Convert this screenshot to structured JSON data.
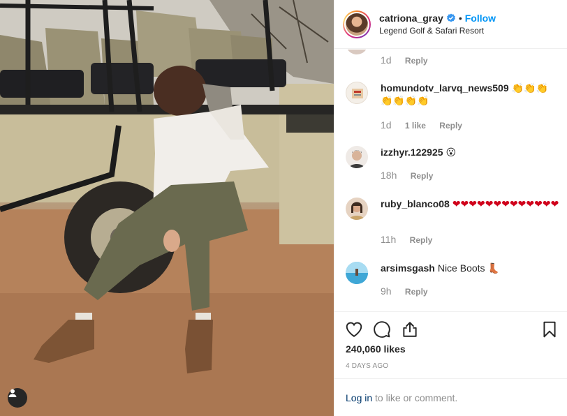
{
  "photo": {
    "description_icon": "user-tag-icon"
  },
  "header": {
    "username": "catriona_gray",
    "verified_icon": "verified-badge-icon",
    "separator": "•",
    "follow_label": "Follow",
    "location": "Legend Golf & Safari Resort"
  },
  "comments": [
    {
      "username": "",
      "text": "",
      "time": "1d",
      "likes": "",
      "reply": "Reply"
    },
    {
      "username": "homundotv_larvq_news509",
      "text": "👏👏👏👏👏👏👏",
      "time": "1d",
      "likes": "1 like",
      "reply": "Reply"
    },
    {
      "username": "izzhyr.122925",
      "text": "😮",
      "time": "18h",
      "likes": "",
      "reply": "Reply"
    },
    {
      "username": "ruby_blanco08",
      "text": "❤❤❤❤❤❤❤❤❤❤❤❤❤",
      "time": "11h",
      "likes": "",
      "reply": "Reply"
    },
    {
      "username": "arsimsgash",
      "text": "Nice Boots 👢",
      "time": "9h",
      "likes": "",
      "reply": "Reply"
    }
  ],
  "actions": {
    "like_icon": "heart-icon",
    "comment_icon": "comment-icon",
    "share_icon": "share-icon",
    "save_icon": "bookmark-icon",
    "likes_count": "240,060 likes",
    "date": "4 DAYS AGO"
  },
  "login": {
    "link_label": "Log in",
    "rest_text": " to like or comment."
  },
  "colors": {
    "link_blue": "#0095f6",
    "text_primary": "#262626",
    "text_secondary": "#8e8e8e",
    "heart_red": "#d0021b"
  }
}
